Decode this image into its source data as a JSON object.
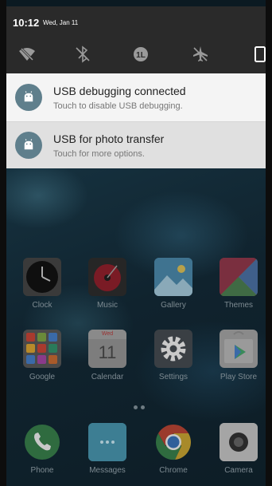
{
  "status": {
    "time": "10:12",
    "date": "Wed, Jan 11"
  },
  "quick_settings": {
    "icons": [
      "wifi-off-icon",
      "bluetooth-off-icon",
      "data-saver-icon",
      "airplane-mode-icon",
      "screen-rotation-icon"
    ]
  },
  "notifications": [
    {
      "title": "USB debugging connected",
      "subtitle": "Touch to disable USB debugging.",
      "icon": "android-icon"
    },
    {
      "title": "USB for photo transfer",
      "subtitle": "Touch for more options.",
      "icon": "android-icon"
    }
  ],
  "apps": {
    "row1": [
      {
        "label": "Clock"
      },
      {
        "label": "Music"
      },
      {
        "label": "Gallery"
      },
      {
        "label": "Themes"
      }
    ],
    "row2": [
      {
        "label": "Google"
      },
      {
        "label": "Calendar",
        "date_day": "Wed",
        "date_num": "11"
      },
      {
        "label": "Settings"
      },
      {
        "label": "Play Store"
      }
    ],
    "dock": [
      {
        "label": "Phone"
      },
      {
        "label": "Messages"
      },
      {
        "label": "Chrome"
      },
      {
        "label": "Camera"
      }
    ]
  },
  "colors": {
    "qs_bg": "#2a2a2a",
    "notif_bg": "#f4f4f4",
    "badge": "#5f7f8c"
  }
}
